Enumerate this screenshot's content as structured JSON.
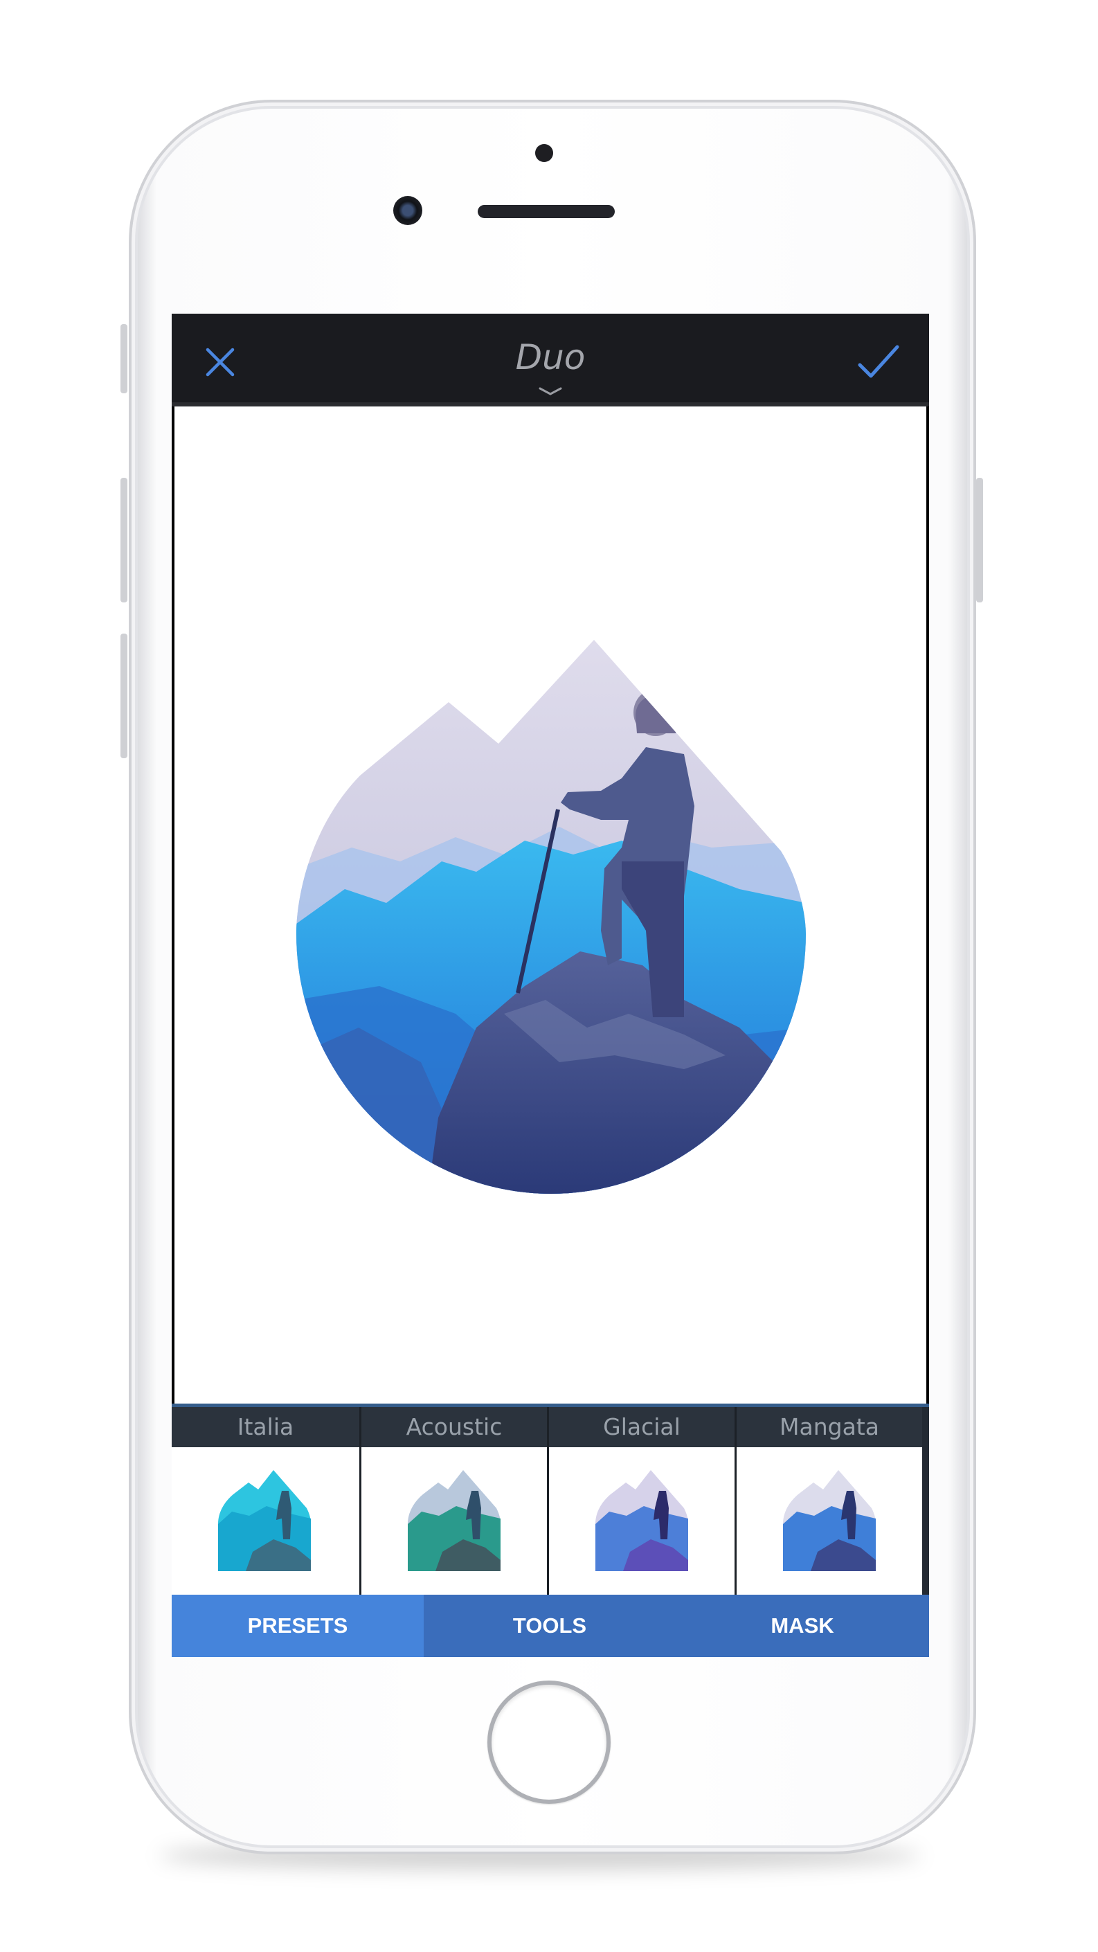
{
  "app": {
    "title": "Duo",
    "close_icon": "close-x-icon",
    "confirm_icon": "checkmark-icon",
    "title_chevron_icon": "chevron-down-icon"
  },
  "presets": [
    {
      "label": "Italia",
      "tint": "#2dc5e0"
    },
    {
      "label": "Acoustic",
      "tint": "#2a9a8c"
    },
    {
      "label": "Glacial",
      "tint": "#5c4fb8"
    },
    {
      "label": "Mangata",
      "tint": "#3b63c6"
    }
  ],
  "tabs": [
    {
      "label": "PRESETS",
      "active": true
    },
    {
      "label": "TOOLS",
      "active": false
    },
    {
      "label": "MASK",
      "active": false
    }
  ],
  "colors": {
    "top_bar": "#1a1b1f",
    "accent_blue": "#3a6dbb",
    "active_tab": "#4584db",
    "photo_blue": "#2f9be6"
  }
}
